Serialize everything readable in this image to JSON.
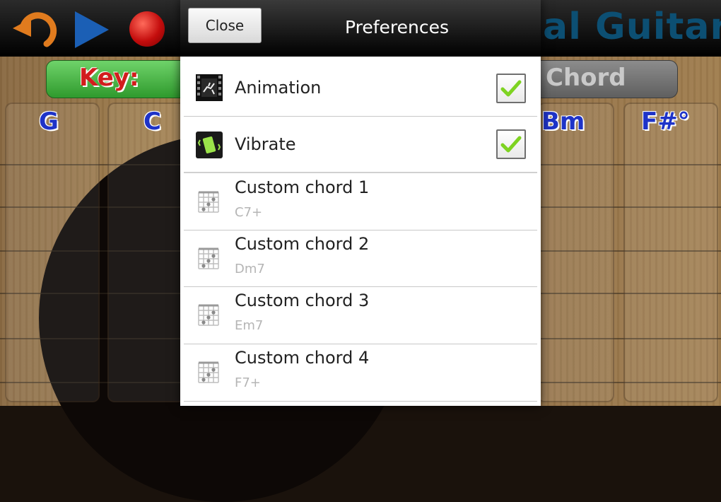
{
  "app": {
    "title": "al Guitar",
    "key_label": "Key:",
    "chord_label": "Chord",
    "chords": [
      "G",
      "C",
      "Bm",
      "F#°"
    ]
  },
  "dialog": {
    "close_label": "Close",
    "title": "Preferences",
    "items": [
      {
        "title": "Animation",
        "icon": "animation-icon",
        "checked": true
      },
      {
        "title": "Vibrate",
        "icon": "vibrate-icon",
        "checked": true
      }
    ],
    "custom_chords": [
      {
        "title": "Custom chord 1",
        "summary": "C7+",
        "icon": "chord-diagram-icon"
      },
      {
        "title": "Custom chord 2",
        "summary": "Dm7",
        "icon": "chord-diagram-icon"
      },
      {
        "title": "Custom chord 3",
        "summary": "Em7",
        "icon": "chord-diagram-icon"
      },
      {
        "title": "Custom chord 4",
        "summary": "F7+",
        "icon": "chord-diagram-icon"
      }
    ]
  },
  "colors": {
    "record_red": "#c40d0d",
    "play_blue": "#1b5fb5",
    "undo_orange": "#e07b1e",
    "check_green": "#7ed321",
    "chord_blue": "#1e33c8",
    "key_red": "#d21d1d"
  }
}
